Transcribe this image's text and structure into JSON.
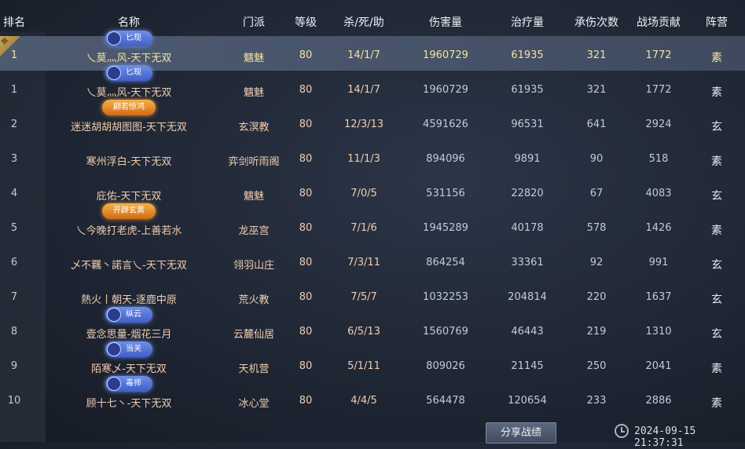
{
  "headers": {
    "rank": "排名",
    "name": "名称",
    "sect": "门派",
    "level": "等级",
    "kda": "杀/死/助",
    "damage": "伤害量",
    "heal": "治疗量",
    "taken": "承伤次数",
    "contribution": "战场贡献",
    "camp": "阵营"
  },
  "self_flag": "我",
  "rows": [
    {
      "rank": "1",
      "name": "乀莫灬风-天下无双",
      "badge": "匕现",
      "sect": "魑魅",
      "level": "80",
      "kda": "14/1/7",
      "damage": "1960729",
      "heal": "61935",
      "taken": "321",
      "contribution": "1772",
      "camp": "素"
    },
    {
      "rank": "1",
      "name": "乀莫灬风-天下无双",
      "badge": "匕现",
      "sect": "魑魅",
      "level": "80",
      "kda": "14/1/7",
      "damage": "1960729",
      "heal": "61935",
      "taken": "321",
      "contribution": "1772",
      "camp": "素"
    },
    {
      "rank": "2",
      "name": "迷迷胡胡胡图图-天下无双",
      "badge": "翩若惊鸿",
      "sect": "玄溟教",
      "level": "80",
      "kda": "12/3/13",
      "damage": "4591626",
      "heal": "96531",
      "taken": "641",
      "contribution": "2924",
      "camp": "玄"
    },
    {
      "rank": "3",
      "name": "寒州浮白-天下无双",
      "badge": "",
      "sect": "弈剑听雨阁",
      "level": "80",
      "kda": "11/1/3",
      "damage": "894096",
      "heal": "9891",
      "taken": "90",
      "contribution": "518",
      "camp": "素"
    },
    {
      "rank": "4",
      "name": "庇佑-天下无双",
      "badge": "",
      "sect": "魑魅",
      "level": "80",
      "kda": "7/0/5",
      "damage": "531156",
      "heal": "22820",
      "taken": "67",
      "contribution": "4083",
      "camp": "玄"
    },
    {
      "rank": "5",
      "name": "乀今晚打老虎-上善若水",
      "badge": "开辟玄黄",
      "sect": "龙巫宫",
      "level": "80",
      "kda": "7/1/6",
      "damage": "1945289",
      "heal": "40178",
      "taken": "578",
      "contribution": "1426",
      "camp": "素"
    },
    {
      "rank": "6",
      "name": "乄不羈丶諾言乀-天下无双",
      "badge": "",
      "sect": "翎羽山庄",
      "level": "80",
      "kda": "7/3/11",
      "damage": "864254",
      "heal": "33361",
      "taken": "92",
      "contribution": "991",
      "camp": "玄"
    },
    {
      "rank": "7",
      "name": "熱火丨朝天-逐鹿中原",
      "badge": "",
      "sect": "荒火教",
      "level": "80",
      "kda": "7/5/7",
      "damage": "1032253",
      "heal": "204814",
      "taken": "220",
      "contribution": "1637",
      "camp": "玄"
    },
    {
      "rank": "8",
      "name": "壹念思量-烟花三月",
      "badge": "纵云",
      "sect": "云麓仙居",
      "level": "80",
      "kda": "6/5/13",
      "damage": "1560769",
      "heal": "46443",
      "taken": "219",
      "contribution": "1310",
      "camp": "玄"
    },
    {
      "rank": "9",
      "name": "陌寒乄-天下无双",
      "badge": "当关",
      "sect": "天机营",
      "level": "80",
      "kda": "5/1/11",
      "damage": "809026",
      "heal": "21145",
      "taken": "250",
      "contribution": "2041",
      "camp": "素"
    },
    {
      "rank": "10",
      "name": "顾十七丶-天下无双",
      "badge": "毒师",
      "sect": "冰心堂",
      "level": "80",
      "kda": "4/4/5",
      "damage": "564478",
      "heal": "120654",
      "taken": "233",
      "contribution": "2886",
      "camp": "素"
    }
  ],
  "footer": {
    "share_label": "分享战绩",
    "timestamp": "2024-09-15 21:37:31"
  }
}
